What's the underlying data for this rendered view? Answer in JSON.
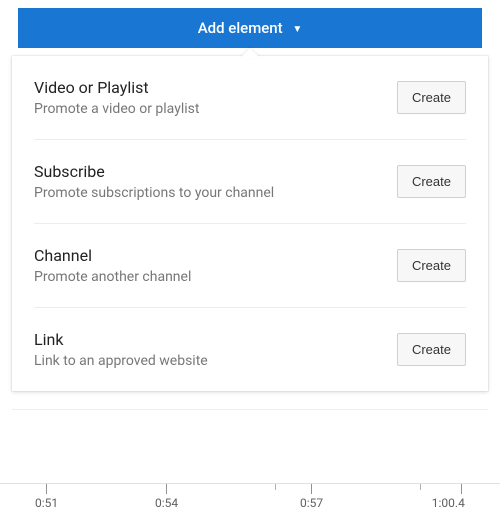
{
  "header": {
    "add_element_label": "Add element"
  },
  "options": [
    {
      "name": "video-or-playlist",
      "title": "Video or Playlist",
      "desc": "Promote a video or playlist",
      "button": "Create"
    },
    {
      "name": "subscribe",
      "title": "Subscribe",
      "desc": "Promote subscriptions to your channel",
      "button": "Create"
    },
    {
      "name": "channel",
      "title": "Channel",
      "desc": "Promote another channel",
      "button": "Create"
    },
    {
      "name": "link",
      "title": "Link",
      "desc": "Link to an approved website",
      "button": "Create"
    }
  ],
  "timeline": {
    "ticks": [
      {
        "pos": 7,
        "label": "0:51",
        "long": true
      },
      {
        "pos": 31,
        "label": "0:54",
        "long": true
      },
      {
        "pos": 55,
        "label": "",
        "long": false
      },
      {
        "pos": 60,
        "label": "0:57",
        "long": true
      },
      {
        "pos": 84,
        "label": "",
        "long": false
      },
      {
        "pos": 89,
        "label": "1:00.4",
        "long": true,
        "align": "right"
      }
    ]
  }
}
